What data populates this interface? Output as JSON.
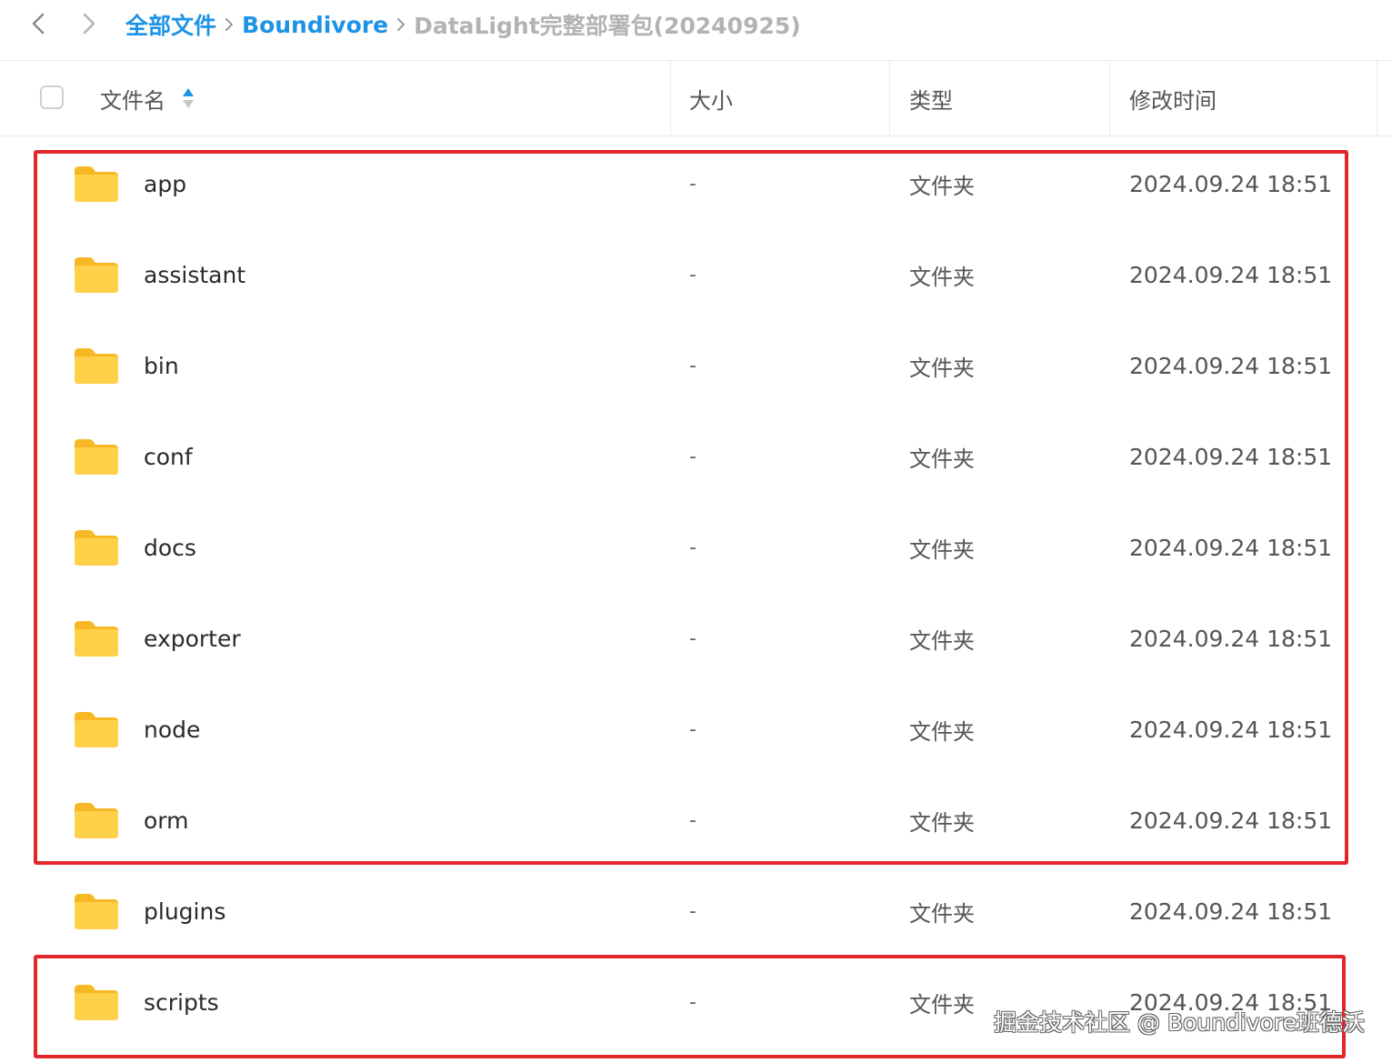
{
  "nav": {
    "back_icon": "chevron-left-icon",
    "forward_icon": "chevron-right-icon",
    "breadcrumb": [
      {
        "label": "全部文件"
      },
      {
        "label": "Boundivore"
      },
      {
        "label": "DataLight完整部署包(20240925)"
      }
    ]
  },
  "header": {
    "name_label": "文件名",
    "size_label": "大小",
    "type_label": "类型",
    "time_label": "修改时间",
    "sort_icon": "sort-arrows-icon"
  },
  "files": [
    {
      "name": "app",
      "size": "-",
      "type": "文件夹",
      "modified": "2024.09.24 18:51"
    },
    {
      "name": "assistant",
      "size": "-",
      "type": "文件夹",
      "modified": "2024.09.24 18:51"
    },
    {
      "name": "bin",
      "size": "-",
      "type": "文件夹",
      "modified": "2024.09.24 18:51"
    },
    {
      "name": "conf",
      "size": "-",
      "type": "文件夹",
      "modified": "2024.09.24 18:51"
    },
    {
      "name": "docs",
      "size": "-",
      "type": "文件夹",
      "modified": "2024.09.24 18:51"
    },
    {
      "name": "exporter",
      "size": "-",
      "type": "文件夹",
      "modified": "2024.09.24 18:51"
    },
    {
      "name": "node",
      "size": "-",
      "type": "文件夹",
      "modified": "2024.09.24 18:51"
    },
    {
      "name": "orm",
      "size": "-",
      "type": "文件夹",
      "modified": "2024.09.24 18:51"
    },
    {
      "name": "plugins",
      "size": "-",
      "type": "文件夹",
      "modified": "2024.09.24 18:51"
    },
    {
      "name": "scripts",
      "size": "-",
      "type": "文件夹",
      "modified": "2024.09.24 18:51"
    }
  ],
  "watermark": "掘金技术社区 @ Boundivore班德沃",
  "colors": {
    "link": "#1e93e6",
    "current_crumb": "#b3b3b3",
    "highlight": "#e2262a",
    "folder": "#ffc930"
  }
}
